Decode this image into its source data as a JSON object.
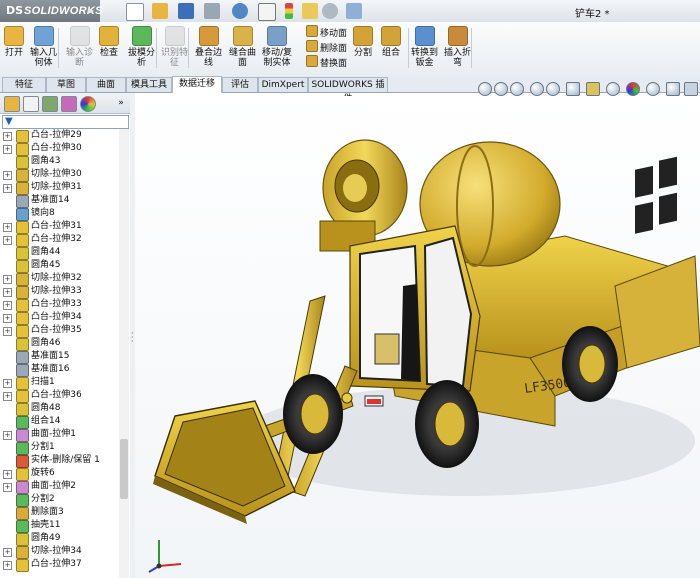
{
  "app": {
    "logo_prefix": "DS",
    "logo_text": "SOLIDWORKS",
    "document_title": "铲车2 *"
  },
  "toolbar": {
    "tools": [
      {
        "label": "打开",
        "icon": "open-folder-icon",
        "color": "#e8b640",
        "disabled": false
      },
      {
        "label": "输入几\n何体",
        "icon": "import-geometry-icon",
        "color": "#6fa3d8",
        "disabled": false
      },
      {
        "label": "输入诊\n断",
        "icon": "import-diagnostics-icon",
        "color": "#c9c9c9",
        "disabled": true
      },
      {
        "label": "检查",
        "icon": "check-icon",
        "color": "#e3b23a",
        "disabled": false
      },
      {
        "label": "拔模分\n析",
        "icon": "draft-analysis-icon",
        "color": "#5bb85b",
        "disabled": false
      },
      {
        "label": "识别特\n征",
        "icon": "recognize-features-icon",
        "color": "#c9c9c9",
        "disabled": true
      },
      {
        "label": "叠合边\n线",
        "icon": "stitch-edges-icon",
        "color": "#d79a3a",
        "disabled": false
      },
      {
        "label": "缝合曲\n面",
        "icon": "knit-surface-icon",
        "color": "#d9b24a",
        "disabled": false
      },
      {
        "label": "移动/复\n制实体",
        "icon": "move-copy-body-icon",
        "color": "#7aa0c8",
        "disabled": false
      },
      {
        "label": "分割",
        "icon": "split-icon",
        "color": "#d4a338",
        "disabled": false
      },
      {
        "label": "组合",
        "icon": "combine-icon",
        "color": "#d4a338",
        "disabled": false
      },
      {
        "label": "转换到\n钣金",
        "icon": "convert-sheet-metal-icon",
        "color": "#5a8fd0",
        "disabled": false
      },
      {
        "label": "插入折\n弯",
        "icon": "insert-bends-icon",
        "color": "#c98a3a",
        "disabled": false
      }
    ],
    "small_tools": [
      {
        "label": "移动面",
        "icon": "move-face-icon",
        "color": "#d9a93c"
      },
      {
        "label": "删除面",
        "icon": "delete-face-icon",
        "color": "#d9a93c"
      },
      {
        "label": "替换面",
        "icon": "replace-face-icon",
        "color": "#d9a93c"
      }
    ]
  },
  "tabs": [
    {
      "label": "特征",
      "active": false
    },
    {
      "label": "草图",
      "active": false
    },
    {
      "label": "曲面",
      "active": false
    },
    {
      "label": "模具工具",
      "active": false
    },
    {
      "label": "数据迁移",
      "active": true
    },
    {
      "label": "评估",
      "active": false
    },
    {
      "label": "DimXpert",
      "active": false
    },
    {
      "label": "SOLIDWORKS 插件",
      "active": false
    }
  ],
  "tree": [
    {
      "label": "凸台-拉伸29",
      "icon": "extrude-boss-icon",
      "color": "#e3c23a",
      "expandable": true
    },
    {
      "label": "凸台-拉伸30",
      "icon": "extrude-boss-icon",
      "color": "#e3c23a",
      "expandable": true
    },
    {
      "label": "圆角43",
      "icon": "fillet-icon",
      "color": "#d9c23a",
      "expandable": false
    },
    {
      "label": "切除-拉伸30",
      "icon": "extrude-cut-icon",
      "color": "#d9b23a",
      "expandable": true
    },
    {
      "label": "切除-拉伸31",
      "icon": "extrude-cut-icon",
      "color": "#d9b23a",
      "expandable": true
    },
    {
      "label": "基准面14",
      "icon": "plane-icon",
      "color": "#9aa8b8",
      "expandable": false
    },
    {
      "label": "镜向8",
      "icon": "mirror-icon",
      "color": "#6aa0d0",
      "expandable": false
    },
    {
      "label": "凸台-拉伸31",
      "icon": "extrude-boss-icon",
      "color": "#e3c23a",
      "expandable": true
    },
    {
      "label": "凸台-拉伸32",
      "icon": "extrude-boss-icon",
      "color": "#e3c23a",
      "expandable": true
    },
    {
      "label": "圆角44",
      "icon": "fillet-icon",
      "color": "#d9c23a",
      "expandable": false
    },
    {
      "label": "圆角45",
      "icon": "fillet-icon",
      "color": "#d9c23a",
      "expandable": false
    },
    {
      "label": "切除-拉伸32",
      "icon": "extrude-cut-icon",
      "color": "#d9b23a",
      "expandable": true
    },
    {
      "label": "切除-拉伸33",
      "icon": "extrude-cut-icon",
      "color": "#d9b23a",
      "expandable": true
    },
    {
      "label": "凸台-拉伸33",
      "icon": "extrude-boss-icon",
      "color": "#e3c23a",
      "expandable": true
    },
    {
      "label": "凸台-拉伸34",
      "icon": "extrude-boss-icon",
      "color": "#e3c23a",
      "expandable": true
    },
    {
      "label": "凸台-拉伸35",
      "icon": "extrude-boss-icon",
      "color": "#e3c23a",
      "expandable": true
    },
    {
      "label": "圆角46",
      "icon": "fillet-icon",
      "color": "#d9c23a",
      "expandable": false
    },
    {
      "label": "基准面15",
      "icon": "plane-icon",
      "color": "#9aa8b8",
      "expandable": false
    },
    {
      "label": "基准面16",
      "icon": "plane-icon",
      "color": "#9aa8b8",
      "expandable": false
    },
    {
      "label": "扫描1",
      "icon": "sweep-icon",
      "color": "#e3c23a",
      "expandable": true
    },
    {
      "label": "凸台-拉伸36",
      "icon": "extrude-boss-icon",
      "color": "#e3c23a",
      "expandable": true
    },
    {
      "label": "圆角48",
      "icon": "fillet-icon",
      "color": "#d9c23a",
      "expandable": false
    },
    {
      "label": "组合14",
      "icon": "combine-icon",
      "color": "#5bb85b",
      "expandable": false
    },
    {
      "label": "曲面-拉伸1",
      "icon": "surface-extrude-icon",
      "color": "#c98ad0",
      "expandable": true
    },
    {
      "label": "分割1",
      "icon": "split-icon",
      "color": "#5bb85b",
      "expandable": false
    },
    {
      "label": "实体-删除/保留 1",
      "icon": "delete-body-icon",
      "color": "#d95b3a",
      "expandable": false
    },
    {
      "label": "旋转6",
      "icon": "revolve-icon",
      "color": "#e3c23a",
      "expandable": true
    },
    {
      "label": "曲面-拉伸2",
      "icon": "surface-extrude-icon",
      "color": "#c98ad0",
      "expandable": true
    },
    {
      "label": "分割2",
      "icon": "split-icon",
      "color": "#5bb85b",
      "expandable": false
    },
    {
      "label": "删除面3",
      "icon": "delete-face-icon",
      "color": "#d9a93c",
      "expandable": false
    },
    {
      "label": "抽壳11",
      "icon": "shell-icon",
      "color": "#5bb85b",
      "expandable": false
    },
    {
      "label": "圆角49",
      "icon": "fillet-icon",
      "color": "#d9c23a",
      "expandable": false
    },
    {
      "label": "切除-拉伸34",
      "icon": "extrude-cut-icon",
      "color": "#d9b23a",
      "expandable": true
    },
    {
      "label": "凸台-拉伸37",
      "icon": "extrude-boss-icon",
      "color": "#e3c23a",
      "expandable": true
    }
  ],
  "model": {
    "plate_text": "LF3500"
  }
}
